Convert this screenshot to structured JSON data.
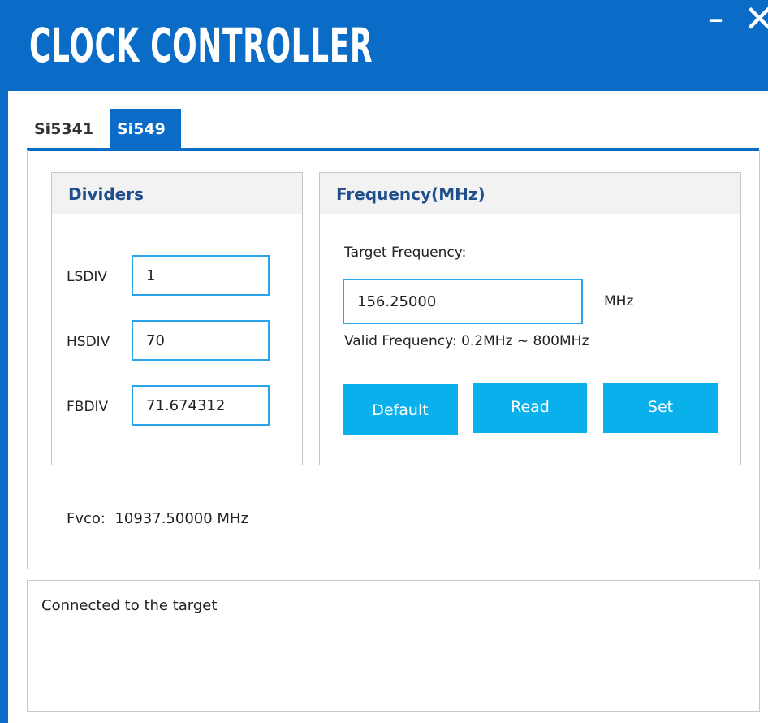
{
  "window": {
    "title": "CLOCK CONTROLLER",
    "minimize_glyph": "–",
    "close_glyph": "✕"
  },
  "tabs": [
    {
      "label": "Si5341",
      "active": false
    },
    {
      "label": "Si549",
      "active": true
    }
  ],
  "dividers": {
    "title": "Dividers",
    "fields": [
      {
        "label": "LSDIV",
        "value": "1"
      },
      {
        "label": "HSDIV",
        "value": "70"
      },
      {
        "label": "FBDIV",
        "value": "71.674312"
      }
    ]
  },
  "frequency": {
    "title": "Frequency(MHz)",
    "target_label": "Target Frequency:",
    "target_value": "156.25000",
    "unit": "MHz",
    "valid_range": "Valid Frequency: 0.2MHz ~ 800MHz",
    "buttons": {
      "default": "Default",
      "read": "Read",
      "set": "Set"
    }
  },
  "fvco": {
    "label": "Fvco:",
    "value": "10937.50000 MHz"
  },
  "status": {
    "message": "Connected to the target"
  },
  "colors": {
    "brand_blue": "#0a6cc6",
    "button_blue": "#0ab0ec",
    "input_border": "#2aa3e8",
    "group_title": "#1f4e8c"
  }
}
